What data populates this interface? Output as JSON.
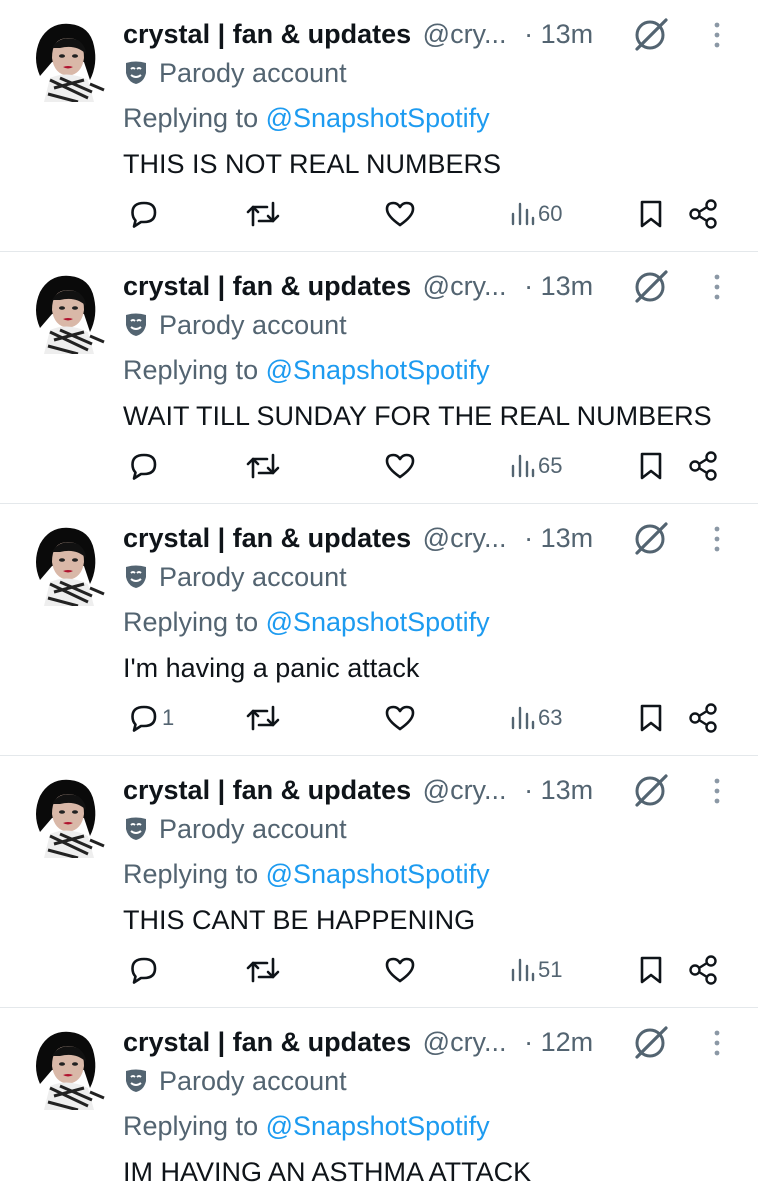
{
  "colors": {
    "text": "#0f1419",
    "secondary": "#536471",
    "link": "#1d9bf0",
    "divider": "#e4e8eb"
  },
  "icons": {
    "reply": "reply-icon",
    "retweet": "retweet-icon",
    "like": "heart-icon",
    "views": "views-icon",
    "bookmark": "bookmark-icon",
    "share": "share-icon",
    "grok": "grok-icon",
    "more": "more-icon",
    "parody": "parody-mask-icon"
  },
  "tweets": [
    {
      "name": "crystal | fan & updates",
      "handle": "@cry...",
      "time": "13m",
      "label": "Parody account",
      "replying_prefix": "Replying to",
      "replying_handle": "@SnapshotSpotify",
      "text": "THIS IS NOT REAL NUMBERS",
      "replies": "",
      "views": "60"
    },
    {
      "name": "crystal | fan & updates",
      "handle": "@cry...",
      "time": "13m",
      "label": "Parody account",
      "replying_prefix": "Replying to",
      "replying_handle": "@SnapshotSpotify",
      "text": "WAIT TILL SUNDAY FOR THE REAL NUMBERS",
      "replies": "",
      "views": "65"
    },
    {
      "name": "crystal | fan & updates",
      "handle": "@cry...",
      "time": "13m",
      "label": "Parody account",
      "replying_prefix": "Replying to",
      "replying_handle": "@SnapshotSpotify",
      "text": "I'm having a panic attack",
      "replies": "1",
      "views": "63"
    },
    {
      "name": "crystal | fan & updates",
      "handle": "@cry...",
      "time": "13m",
      "label": "Parody account",
      "replying_prefix": "Replying to",
      "replying_handle": "@SnapshotSpotify",
      "text": "THIS CANT BE HAPPENING",
      "replies": "",
      "views": "51"
    },
    {
      "name": "crystal | fan & updates",
      "handle": "@cry...",
      "time": "12m",
      "label": "Parody account",
      "replying_prefix": "Replying to",
      "replying_handle": "@SnapshotSpotify",
      "text": "IM HAVING AN ASTHMA ATTACK",
      "replies": "",
      "views": ""
    }
  ]
}
